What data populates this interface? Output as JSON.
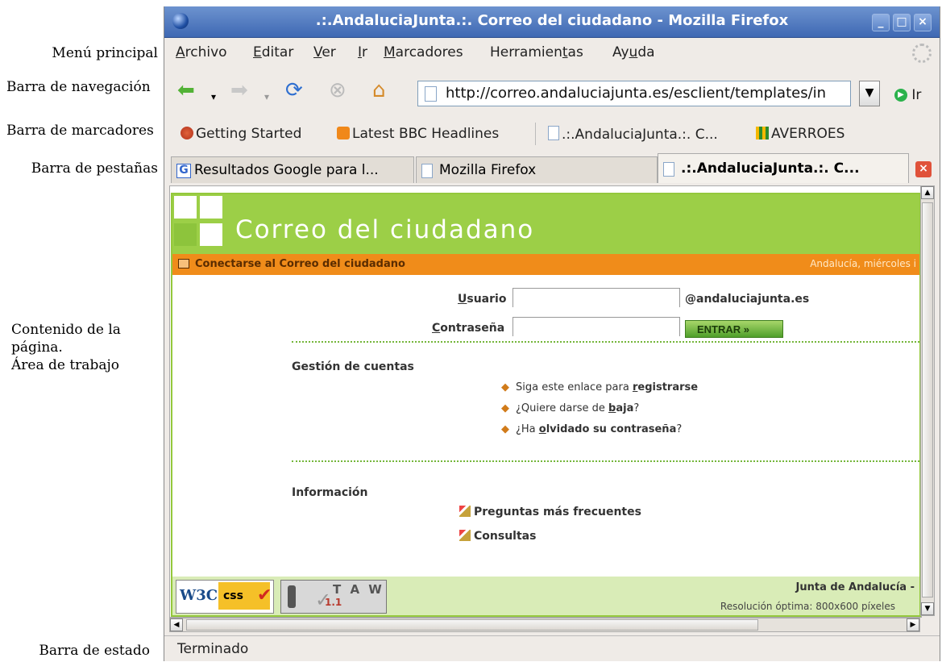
{
  "annotations": {
    "menu": "Menú principal",
    "navigation": "Barra de navegación",
    "bookmarks": "Barra de marcadores",
    "tabs": "Barra de pestañas",
    "content_line1": "Contenido de la",
    "content_line2": "página.",
    "content_line3": "Área de trabajo",
    "status": "Barra de estado"
  },
  "window": {
    "title": ".:.AndaluciaJunta.:. Correo del ciudadano - Mozilla Firefox",
    "btn_min": "_",
    "btn_max": "□",
    "btn_close": "×"
  },
  "menu": {
    "archivo_key": "A",
    "archivo_rest": "rchivo",
    "editar_key": "E",
    "editar_rest": "ditar",
    "ver_key": "V",
    "ver_rest": "er",
    "ir_key": "I",
    "ir_rest": "r",
    "marcadores_key": "M",
    "marcadores_rest": "arcadores",
    "herramientas_pre": "Herramien",
    "herramientas_key": "t",
    "herramientas_post": "as",
    "ayuda_pre": "Ay",
    "ayuda_key": "u",
    "ayuda_post": "da"
  },
  "nav": {
    "url": "http://correo.andaluciajunta.es/esclient/templates/in",
    "go_label": "Ir"
  },
  "bookmarks": [
    {
      "label": "Getting Started",
      "icon": "firefox-icon"
    },
    {
      "label": "Latest BBC Headlines",
      "icon": "rss-icon"
    },
    {
      "label": ".:.AndaluciaJunta.:. C...",
      "icon": "page-icon"
    },
    {
      "label": "AVERROES",
      "icon": "averroes-icon"
    }
  ],
  "tabs": [
    {
      "label": "Resultados Google para l...",
      "icon": "google-icon"
    },
    {
      "label": "Mozilla Firefox",
      "icon": "page-icon"
    },
    {
      "label": ".:.AndaluciaJunta.:. C...",
      "icon": "page-icon",
      "active": true
    }
  ],
  "tab_close": "×",
  "page": {
    "banner_title": "Correo del ciudadano",
    "bar_left": "Conectarse al Correo del ciudadano",
    "bar_right": "Andalucía, miércoles i",
    "usuario_key": "U",
    "usuario_rest": "suario",
    "contrasena_key": "C",
    "contrasena_rest": "ontraseña",
    "domain": "@andaluciajunta.es",
    "entrar": "ENTRAR »",
    "gestion_title": "Gestión de cuentas",
    "link1_pre": "Siga este enlace para ",
    "link1_key": "r",
    "link1_post": "egistrarse",
    "link2_pre": "¿Quiere darse de ",
    "link2_key": "b",
    "link2_post": "aja",
    "link2_end": "?",
    "link3_pre": "¿Ha ",
    "link3_key": "o",
    "link3_post": "lvidado su contraseña",
    "link3_end": "?",
    "info_title": "Información",
    "faq": "Preguntas más frecuentes",
    "consultas": "Consultas",
    "footer_right1": "Junta de Andalucía -",
    "footer_right2": "Resolución óptima: 800x600 píxeles",
    "w3c": "W3C",
    "css": "css",
    "taw": "T A W",
    "taw_version": "1.1"
  },
  "status": "Terminado",
  "colors": {
    "banner_green": "#9ccf47",
    "orange_bar": "#f08c1a",
    "titlebar_blue": "#3e68b3"
  }
}
